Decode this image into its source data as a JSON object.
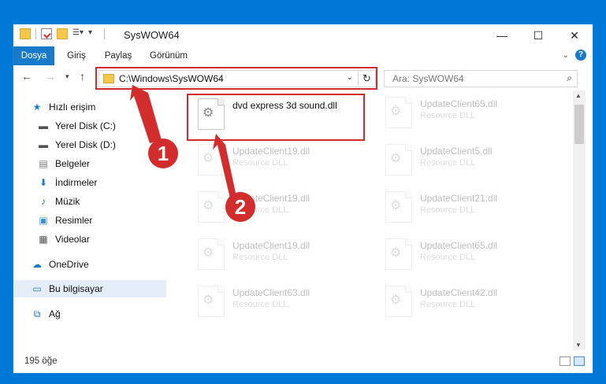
{
  "window": {
    "title": "SysWOW64"
  },
  "ribbon": {
    "tabs": [
      "Dosya",
      "Giriş",
      "Paylaş",
      "Görünüm"
    ]
  },
  "address": {
    "path": "C:\\Windows\\SysWOW64",
    "search_placeholder": "Ara: SysWOW64"
  },
  "sidebar": {
    "items": [
      {
        "label": "Hızlı erişim",
        "icon": "star-icon",
        "pinned": false
      },
      {
        "label": "Yerel Disk (C:)",
        "icon": "drive-icon",
        "pinned": true
      },
      {
        "label": "Yerel Disk (D:)",
        "icon": "drive-icon",
        "pinned": false
      },
      {
        "label": "Belgeler",
        "icon": "documents-icon",
        "pinned": true
      },
      {
        "label": "İndirmeler",
        "icon": "downloads-icon",
        "pinned": true
      },
      {
        "label": "Müzik",
        "icon": "music-icon",
        "pinned": true
      },
      {
        "label": "Resimler",
        "icon": "pictures-icon",
        "pinned": true
      },
      {
        "label": "Videolar",
        "icon": "videos-icon",
        "pinned": true
      },
      {
        "label": "OneDrive",
        "icon": "onedrive-icon",
        "pinned": false
      },
      {
        "label": "Bu bilgisayar",
        "icon": "computer-icon",
        "pinned": false,
        "selected": true
      },
      {
        "label": "Ağ",
        "icon": "network-icon",
        "pinned": false
      }
    ]
  },
  "files": {
    "highlighted": {
      "name": "dvd express 3d sound.dll"
    },
    "col1": [
      {
        "name": "UpdateClient19.dll",
        "type": "Resource DLL"
      },
      {
        "name": "UpdateClient19.dll",
        "type": "Resource DLL"
      },
      {
        "name": "UpdateClient19.dll",
        "type": "Resource DLL"
      },
      {
        "name": "UpdateClient63.dll",
        "type": "Resource DLL"
      }
    ],
    "col2": [
      {
        "name": "UpdateClient65.dll",
        "type": "Resource DLL"
      },
      {
        "name": "UpdateClient5.dll",
        "type": "Resource DLL"
      },
      {
        "name": "UpdateClient21.dll",
        "type": "Resource DLL"
      },
      {
        "name": "UpdateClient65.dll",
        "type": "Resource DLL"
      },
      {
        "name": "UpdateClient42.dll",
        "type": "Resource DLL"
      }
    ]
  },
  "status": {
    "count": "195 öğe"
  },
  "annotations": {
    "badge1": "1",
    "badge2": "2"
  },
  "colors": {
    "accent": "#1979ca",
    "annotation": "#d32c2c"
  }
}
